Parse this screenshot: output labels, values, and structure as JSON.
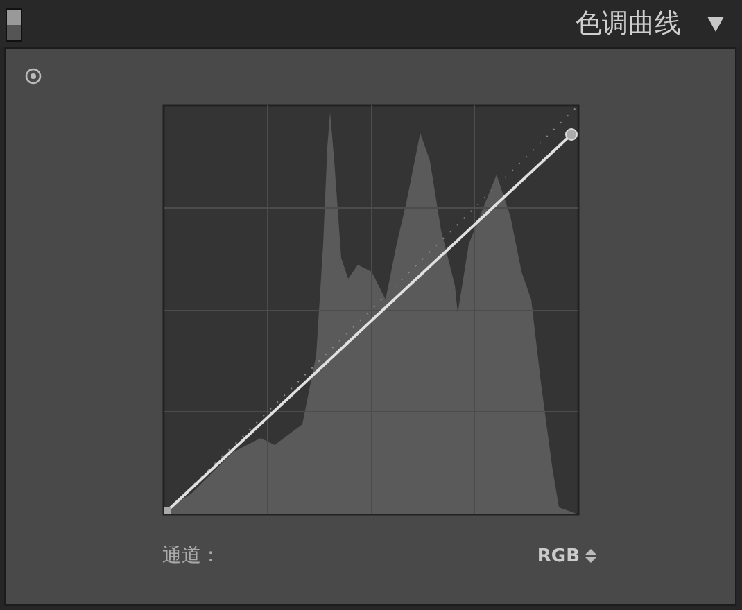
{
  "panel": {
    "title": "色调曲线",
    "expanded": true,
    "enabled": true
  },
  "channel": {
    "label": "通道 :",
    "value": "RGB"
  }
}
